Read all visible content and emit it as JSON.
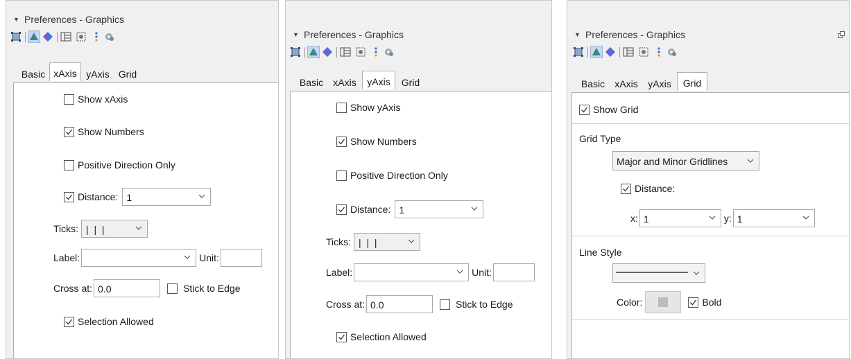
{
  "panels": [
    {
      "title": "Preferences - Graphics",
      "tabs": [
        "Basic",
        "xAxis",
        "yAxis",
        "Grid"
      ],
      "active_tab": "xAxis",
      "show_axis_label": "Show xAxis",
      "show_axis_checked": false,
      "show_numbers_label": "Show Numbers",
      "show_numbers_checked": true,
      "positive_direction_label": "Positive Direction Only",
      "positive_direction_checked": false,
      "distance_label": "Distance:",
      "distance_checked": true,
      "distance_value": "1",
      "ticks_label": "Ticks:",
      "ticks_value": "|  |  |",
      "label_label": "Label:",
      "label_value": "",
      "unit_label": "Unit:",
      "unit_value": "",
      "cross_at_label": "Cross at:",
      "cross_at_value": "0.0",
      "stick_to_edge_label": "Stick to Edge",
      "stick_to_edge_checked": false,
      "selection_allowed_label": "Selection Allowed",
      "selection_allowed_checked": true
    },
    {
      "title": "Preferences - Graphics",
      "tabs": [
        "Basic",
        "xAxis",
        "yAxis",
        "Grid"
      ],
      "active_tab": "yAxis",
      "show_axis_label": "Show yAxis",
      "show_axis_checked": false,
      "show_numbers_label": "Show Numbers",
      "show_numbers_checked": true,
      "positive_direction_label": "Positive Direction Only",
      "positive_direction_checked": false,
      "distance_label": "Distance:",
      "distance_checked": true,
      "distance_value": "1",
      "ticks_label": "Ticks:",
      "ticks_value": "|  |  |",
      "label_label": "Label:",
      "label_value": "",
      "unit_label": "Unit:",
      "unit_value": "",
      "cross_at_label": "Cross at:",
      "cross_at_value": "0.0",
      "stick_to_edge_label": "Stick to Edge",
      "stick_to_edge_checked": false,
      "selection_allowed_label": "Selection Allowed",
      "selection_allowed_checked": true
    },
    {
      "title": "Preferences - Graphics",
      "tabs": [
        "Basic",
        "xAxis",
        "yAxis",
        "Grid"
      ],
      "active_tab": "Grid",
      "undock_icon": "undock-icon",
      "show_grid_label": "Show Grid",
      "show_grid_checked": true,
      "grid_type_heading": "Grid Type",
      "grid_type_value": "Major and Minor Gridlines",
      "distance_label": "Distance:",
      "distance_checked": true,
      "x_label": "x:",
      "x_value": "1",
      "y_label": "y:",
      "y_value": "1",
      "line_style_heading": "Line Style",
      "color_label": "Color:",
      "color_value": "#bdbdbd",
      "bold_label": "Bold",
      "bold_checked": true
    }
  ],
  "toolbar_icons": [
    "graphics-view-icon",
    "graphics-3d-icon",
    "graphics-3d-alt-icon",
    "layout-icon",
    "spreadsheet-icon",
    "algebra-icon",
    "settings-icon"
  ]
}
